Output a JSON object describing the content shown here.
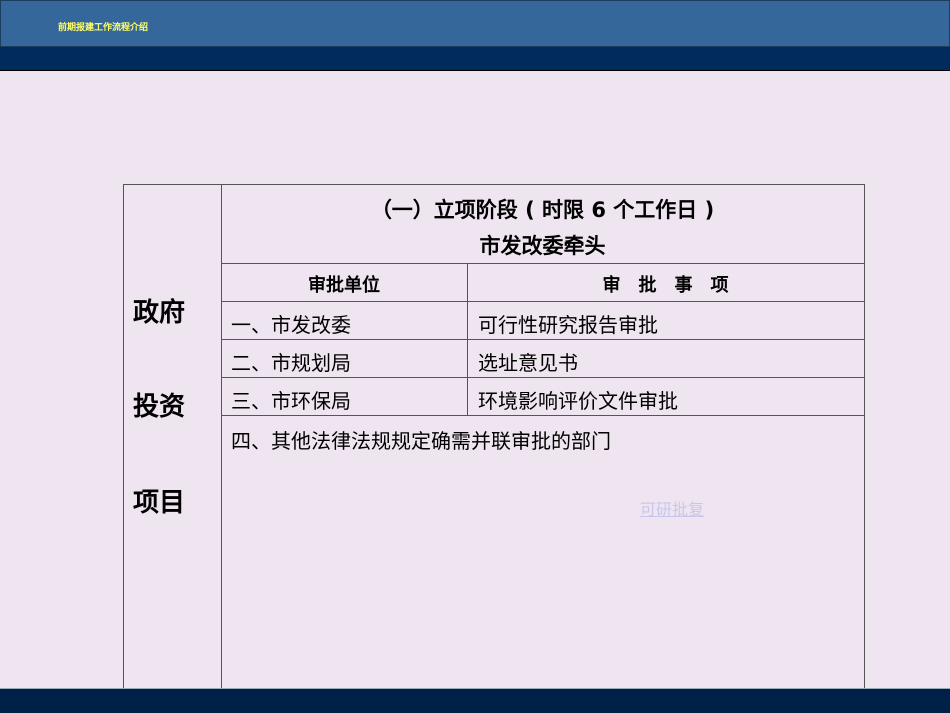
{
  "header": {
    "title": "前期报建工作流程介绍"
  },
  "table": {
    "side_label": [
      "政府",
      "投资",
      "项目"
    ],
    "title_line1": "（一）立项阶段 ( 时限 6 个工作日 )",
    "title_line2": "市发改委牵头",
    "col_headers": [
      "审批单位",
      "审　批　事　项"
    ],
    "rows": [
      {
        "unit": "一、市发改委",
        "item": "可行性研究报告审批"
      },
      {
        "unit": "二、市规划局",
        "item": "选址意见书"
      },
      {
        "unit": "三、市环保局",
        "item": "环境影响评价文件审批"
      }
    ],
    "note": "四、其他法律法规规定确需并联审批的部门",
    "link": "可研批复"
  }
}
